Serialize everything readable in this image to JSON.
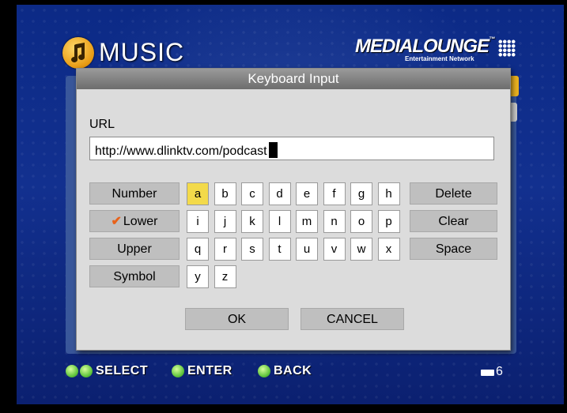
{
  "header": {
    "title": "MUSIC",
    "brand": "MEDIALOUNGE",
    "brand_tm": "™",
    "brand_subtitle": "Entertainment Network"
  },
  "dialog": {
    "title": "Keyboard Input",
    "url_label": "URL",
    "url_value": "http://www.dlinktv.com/podcast",
    "modes": [
      {
        "label": "Number",
        "checked": false
      },
      {
        "label": "Lower",
        "checked": true
      },
      {
        "label": "Upper",
        "checked": false
      },
      {
        "label": "Symbol",
        "checked": false
      }
    ],
    "check_mark": "✔",
    "keys": [
      "a",
      "b",
      "c",
      "d",
      "e",
      "f",
      "g",
      "h",
      "i",
      "j",
      "k",
      "l",
      "m",
      "n",
      "o",
      "p",
      "q",
      "r",
      "s",
      "t",
      "u",
      "v",
      "w",
      "x",
      "y",
      "z"
    ],
    "selected_key": "a",
    "actions": [
      "Delete",
      "Clear",
      "Space"
    ],
    "ok_label": "OK",
    "cancel_label": "CANCEL"
  },
  "footer": {
    "select_label": "SELECT",
    "enter_label": "ENTER",
    "back_label": "BACK",
    "page_count": "6"
  },
  "colors": {
    "selected_key": "#f3da4a",
    "check_mark": "#e8621a",
    "hint_icon": "#5cc23a"
  },
  "icons": [
    "music-note-icon",
    "up-down-arrows-icon",
    "enter-icon",
    "back-icon",
    "page-icon"
  ]
}
